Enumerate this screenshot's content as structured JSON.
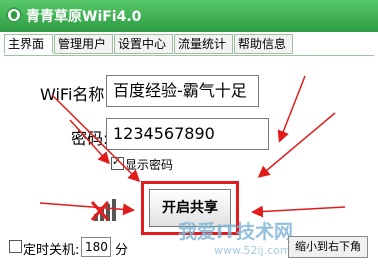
{
  "window": {
    "title": "青青草原WiFi4.0",
    "accent": "#2e9b44"
  },
  "tabs": [
    {
      "label": "主界面",
      "active": true
    },
    {
      "label": "管理用户",
      "active": false
    },
    {
      "label": "设置中心",
      "active": false
    },
    {
      "label": "流量统计",
      "active": false
    },
    {
      "label": "帮助信息",
      "active": false
    }
  ],
  "form": {
    "wifi_label": "WiFi名称:",
    "wifi_value": "百度经验-霸气十足",
    "password_label": "密码:",
    "password_value": "1234567890",
    "show_password_label": "显示密码",
    "show_password_checked": true
  },
  "start_button_label": "开启共享",
  "bottom": {
    "shutdown_label": "定时关机:",
    "shutdown_checked": false,
    "minutes_value": "180",
    "minutes_unit": "分",
    "minimize_label": "缩小到右下角"
  },
  "watermark": {
    "text": "我爱IT技术网",
    "url": "www.52ij.com"
  },
  "annotation_color": "#e21c1c"
}
